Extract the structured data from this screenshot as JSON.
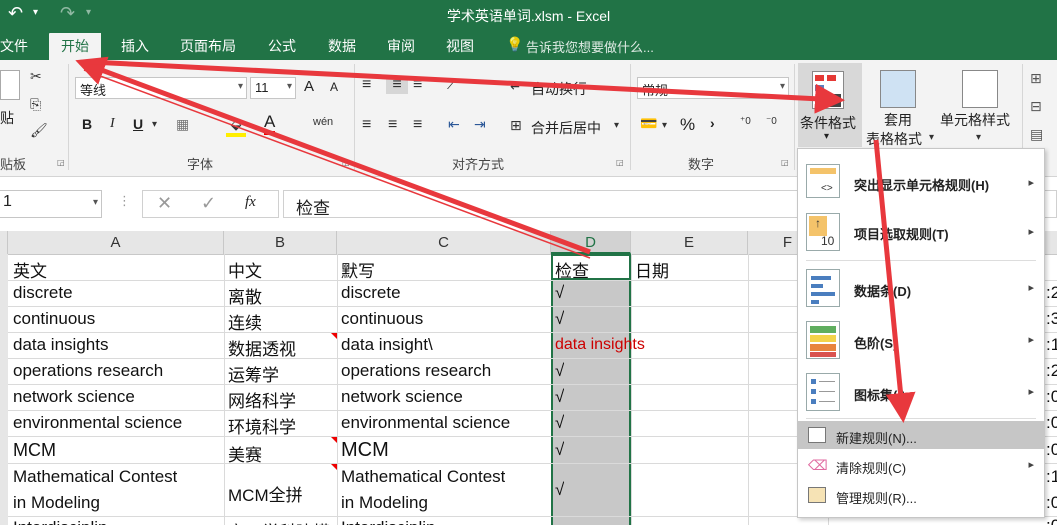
{
  "window": {
    "title": "学术英语单词.xlsm - Excel"
  },
  "tabs": [
    "文件",
    "开始",
    "插入",
    "页面布局",
    "公式",
    "数据",
    "审阅",
    "视图"
  ],
  "tell_me": "告诉我您想要做什么...",
  "ribbon": {
    "clipboard": {
      "paste": "贴",
      "label": "贴板"
    },
    "font": {
      "name": "等线",
      "size": "11",
      "label": "字体",
      "bold": "B",
      "italic": "I",
      "underline": "U",
      "grow": "A",
      "shrink": "A",
      "font_color": "A",
      "phonetic": "wén"
    },
    "alignment": {
      "wrap": "自动换行",
      "merge": "合并后居中",
      "label": "对齐方式"
    },
    "number": {
      "format": "常规",
      "percent": "%",
      "comma": "›",
      "label": "数字"
    },
    "styles": {
      "conditional": "条件格式",
      "table_line1": "套用",
      "table_line2": "表格格式",
      "cell_styles": "单元格样式"
    }
  },
  "formula_bar": {
    "name_box": "1",
    "fx": "fx",
    "value": "检查"
  },
  "columns": [
    "A",
    "B",
    "C",
    "D",
    "E",
    "F"
  ],
  "rows": [
    {
      "a": "英文",
      "b": "中文",
      "c": "默写",
      "d": "检查",
      "e": "日期"
    },
    {
      "a": "discrete",
      "b": "离散",
      "c": "discrete",
      "d": "√",
      "e": ""
    },
    {
      "a": "continuous",
      "b": "连续",
      "c": "continuous",
      "d": "√",
      "e": ""
    },
    {
      "a": "data insights",
      "b": "数据透视",
      "c": "data insight\\",
      "d": "data insights",
      "e": ""
    },
    {
      "a": "operations research",
      "b": "运筹学",
      "c": "operations research",
      "d": "√",
      "e": ""
    },
    {
      "a": "network science",
      "b": "网络科学",
      "c": "network science",
      "d": "√",
      "e": ""
    },
    {
      "a": "environmental science",
      "b": "环境科学",
      "c": "environmental science",
      "d": "√",
      "e": ""
    },
    {
      "a": "MCM",
      "b": "美赛",
      "c": "MCM",
      "d": "√",
      "e": ""
    },
    {
      "a": "Mathematical Contest",
      "a2": "in Modeling",
      "b": "MCM全拼",
      "c": "Mathematical Contest",
      "c2": "in Modeling",
      "d": "√",
      "e": ""
    },
    {
      "a": "Interdisciplin...",
      "b": "交叉学科建模",
      "c": "Interdisciplin...",
      "d": "",
      "e": ""
    }
  ],
  "right_edge": [
    ":2",
    ":3",
    ":1",
    ":2",
    ":0",
    ":0",
    ":0",
    ":1",
    ":0",
    ":0"
  ],
  "cf_menu": {
    "items": [
      {
        "label": "突出显示单元格规则(H)"
      },
      {
        "label": "项目选取规则(T)"
      },
      {
        "label": "数据条(D)"
      },
      {
        "label": "色阶(S)"
      },
      {
        "label": "图标集(I)"
      }
    ],
    "new_rule": "新建规则(N)...",
    "clear_rules": "清除规则(C)",
    "manage_rules": "管理规则(R)...",
    "icon_text": "10"
  },
  "colors": {
    "excel_green": "#217346",
    "arrow_red": "#e8383d",
    "warn_text": "#cc0000"
  }
}
